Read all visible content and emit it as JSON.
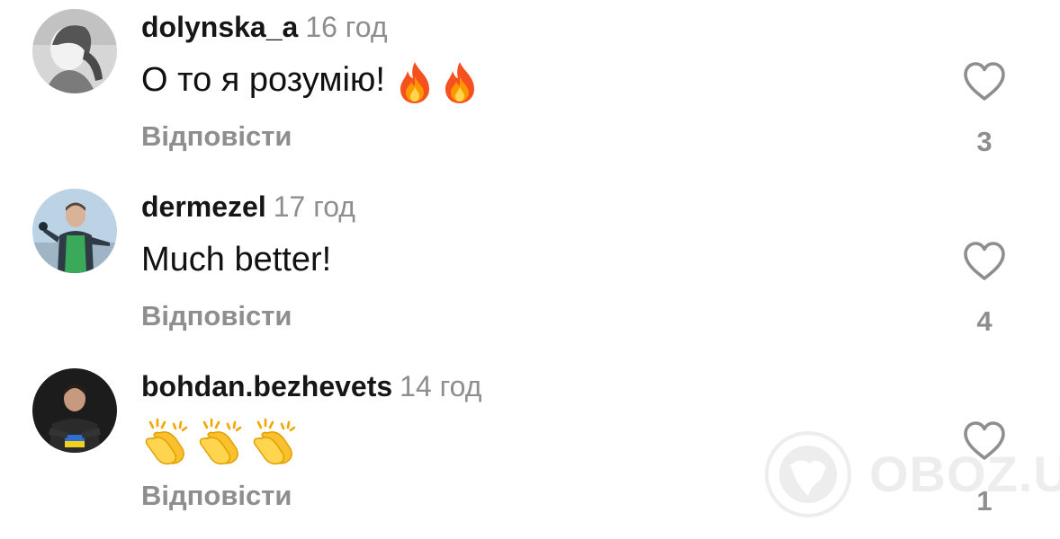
{
  "comments": [
    {
      "username": "dolynska_a",
      "time": "16 год",
      "text": "О то я розумію!",
      "emoji": [
        "fire",
        "fire"
      ],
      "reply_label": "Відповісти",
      "likes": "3"
    },
    {
      "username": "dermezel",
      "time": "17 год",
      "text": "Much better!",
      "emoji": [],
      "reply_label": "Відповісти",
      "likes": "4"
    },
    {
      "username": "bohdan.bezhevets",
      "time": "14 год",
      "text": "",
      "emoji": [
        "clapping-hands",
        "clapping-hands",
        "clapping-hands"
      ],
      "reply_label": "Відповісти",
      "likes": "1"
    }
  ],
  "watermark": {
    "text": "OBOZ.UA"
  },
  "colors": {
    "username": "#161616",
    "secondary_text": "#8e8e8e",
    "body_text": "#111111",
    "background": "#ffffff"
  }
}
